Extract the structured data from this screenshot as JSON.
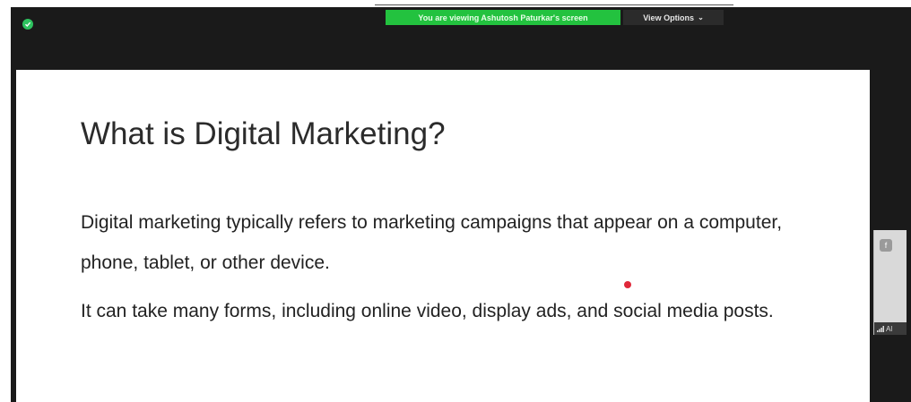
{
  "meeting": {
    "viewing_banner": "You are viewing Ashutosh Paturkar's screen",
    "view_options_label": "View Options",
    "view_options_chevron": "⌄",
    "security_icon": "shield-check-icon",
    "banner_color": "#23c23f"
  },
  "slide": {
    "title": "What is Digital Marketing?",
    "paragraphs": [
      "Digital marketing typically refers to marketing campaigns that appear on a computer, phone, tablet, or other device.",
      "It can take many forms, including online video, display ads, and social media posts."
    ],
    "pointer_color": "#e0283a"
  },
  "participant_thumbnail": {
    "top_icon": "f",
    "signal_icon": "signal-icon",
    "name_fragment": "Al"
  }
}
